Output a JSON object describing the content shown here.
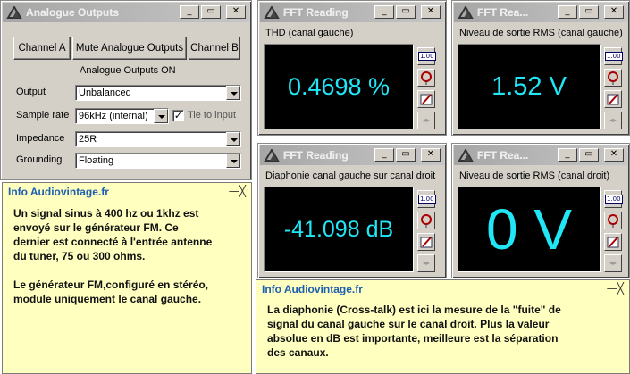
{
  "analogue": {
    "title": "Analogue Outputs",
    "buttons": {
      "channel_a": "Channel A",
      "mute": "Mute Analogue Outputs",
      "channel_b": "Channel B"
    },
    "status": "Analogue Outputs ON",
    "output_label": "Output",
    "output_value": "Unbalanced",
    "sample_rate_label": "Sample rate",
    "sample_rate_value": "96kHz (internal)",
    "tie_label": "Tie to input",
    "tie_mark": "✓",
    "impedance_label": "Impedance",
    "impedance_value": "25R",
    "grounding_label": "Grounding",
    "grounding_value": "Floating"
  },
  "fft": [
    {
      "title": "FFT Reading",
      "label": "THD (canal gauche)",
      "value": "0.4698 %"
    },
    {
      "title": "FFT Rea...",
      "label": "Niveau de sortie RMS (canal gauche)",
      "value": "1.52 V"
    },
    {
      "title": "FFT Reading",
      "label": "Diaphonie canal gauche sur canal droit",
      "value": "-41.098 dB"
    },
    {
      "title": "FFT Rea...",
      "label": "Niveau de sortie RMS (canal droit)",
      "value": "0 V"
    }
  ],
  "tools": {
    "r100": "1.00",
    "nav": "◂▸"
  },
  "title_buttons": {
    "minimize": "_",
    "restore": "▭",
    "close": "✕"
  },
  "info1": {
    "title": "Info Audiovintage.fr",
    "controls": "—╳",
    "text": "Un signal sinus à 400 hz ou 1khz est\nenvoyé sur le générateur FM. Ce\ndernier est connecté à l'entrée antenne\ndu tuner, 75 ou 300 ohms.\n\nLe générateur FM,configuré en stéréo,\nmodule uniquement le canal gauche."
  },
  "info2": {
    "title": "Info Audiovintage.fr",
    "controls": "—╳",
    "text": "La diaphonie (Cross-talk) est ici la mesure de la \"fuite\" de\nsignal du canal gauche sur le canal droit. Plus la valeur\nabsolue en dB est importante, meilleure est la séparation\ndes canaux."
  },
  "colors": {
    "display_text": "#21e6f5",
    "info_bg": "#ffffc0",
    "info_title": "#1c5fb0"
  }
}
